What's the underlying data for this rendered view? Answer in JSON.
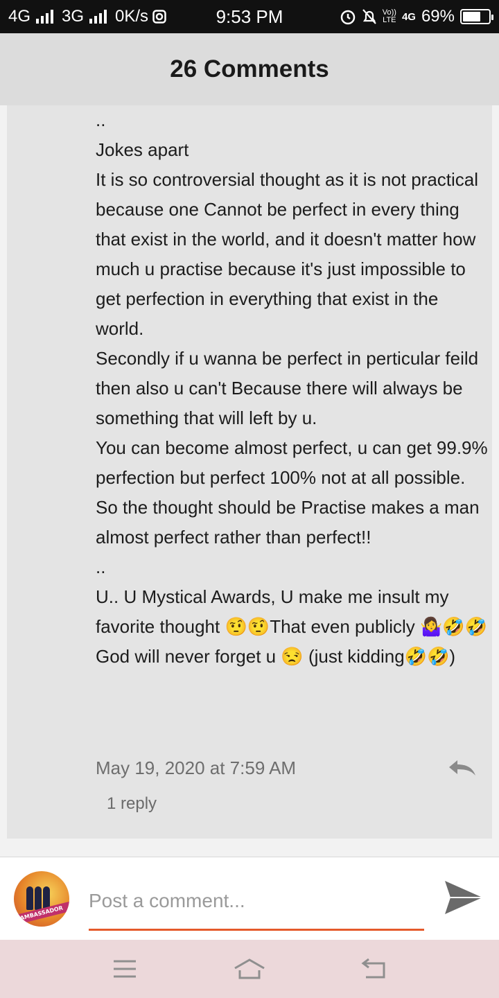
{
  "status_bar": {
    "network1": "4G",
    "network2": "3G",
    "speed": "0K/s",
    "time": "9:53 PM",
    "volte_top": "Vo))",
    "volte_bottom": "LTE",
    "network3": "4G",
    "battery": "69%",
    "battery_level": 0.69
  },
  "header": {
    "title": "26 Comments"
  },
  "comment": {
    "lines": [
      "..",
      "Jokes apart",
      "It is so controversial thought as it is not practical because one Cannot be perfect in every thing that exist in the world, and it doesn't matter how much u practise because it's just impossible to get perfection in everything that exist in the world.",
      "Secondly if u wanna be perfect in perticular feild then also u can't Because there will always be something that will left by u.",
      "You can become almost perfect, u can get 99.9% perfection but perfect 100% not at all possible.",
      "So the thought should be Practise makes a man almost perfect rather than perfect!!",
      "..",
      "U.. U Mystical Awards, U make me insult my favorite thought 🤨🤨That even publicly 🤷‍♀️🤣🤣God will never forget u 😒 (just kidding🤣🤣)"
    ],
    "date": "May 19, 2020 at 7:59 AM",
    "replies": "1 reply"
  },
  "composer": {
    "placeholder": "Post a comment...",
    "avatar_text": "AMBASSADOR",
    "accent": "#e55a2b"
  },
  "colors": {
    "status_bg": "#111111",
    "header_bg": "#dcdcdc",
    "card_bg": "#e4e4e4",
    "nav_bg": "#ecd8da"
  },
  "icons": {
    "reply": "reply-icon",
    "send": "send-icon",
    "menu": "menu-icon",
    "home": "home-icon",
    "back": "back-icon"
  }
}
